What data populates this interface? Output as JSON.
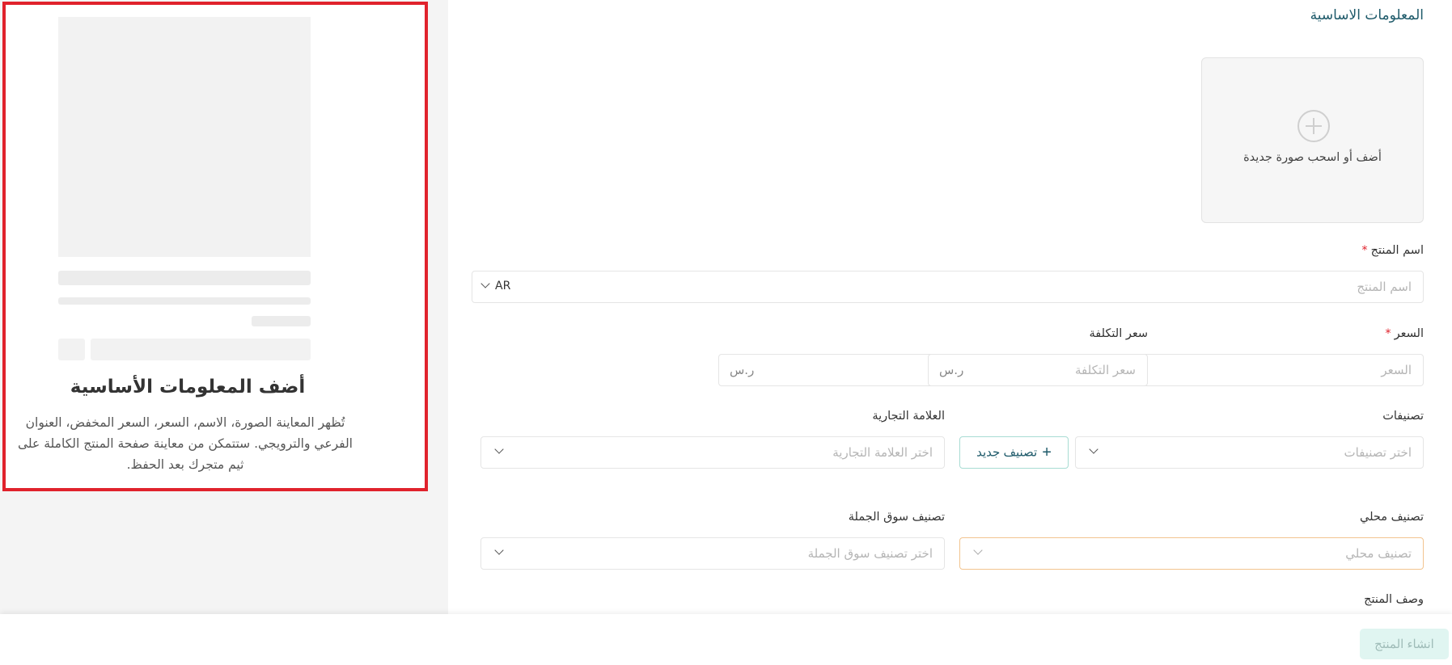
{
  "preview": {
    "title": "أضف المعلومات الأساسية",
    "description": "تُظهر المعاينة الصورة، الاسم، السعر، السعر المخفض، العنوان الفرعي والترويجي. ستتمكن من معاينة صفحة المنتج الكاملة على ثيم متجرك بعد الحفظ."
  },
  "form": {
    "section_title": "المعلومات الاساسية",
    "upload": {
      "icon": "plus-circle-icon",
      "label": "أضف أو اسحب صورة جديدة"
    },
    "product_name": {
      "label": "اسم المنتج",
      "required_mark": "*",
      "placeholder": "اسم المنتج",
      "language": "AR"
    },
    "price": {
      "label": "السعر",
      "required_mark": "*",
      "placeholder": "السعر",
      "currency": "ر.س"
    },
    "cost_price": {
      "label": "سعر التكلفة",
      "placeholder": "سعر التكلفة",
      "currency": "ر.س"
    },
    "categories": {
      "label": "تصنيفات",
      "placeholder": "اختر تصنيفات",
      "new_button": "تصنيف جديد",
      "new_button_icon": "plus-icon"
    },
    "brand": {
      "label": "العلامة التجارية",
      "placeholder": "اختر العلامة التجارية"
    },
    "local_category": {
      "label": "تصنيف محلي",
      "placeholder": "تصنيف محلي"
    },
    "wholesale_category": {
      "label": "تصنيف سوق الجملة",
      "placeholder": "اختر تصنيف سوق الجملة"
    },
    "description": {
      "label": "وصف المنتج"
    }
  },
  "footer": {
    "create_button": "انشاء المنتج"
  },
  "colors": {
    "accent": "#1e5a6a",
    "required": "#e0222c",
    "highlight_border": "#e0222c"
  }
}
